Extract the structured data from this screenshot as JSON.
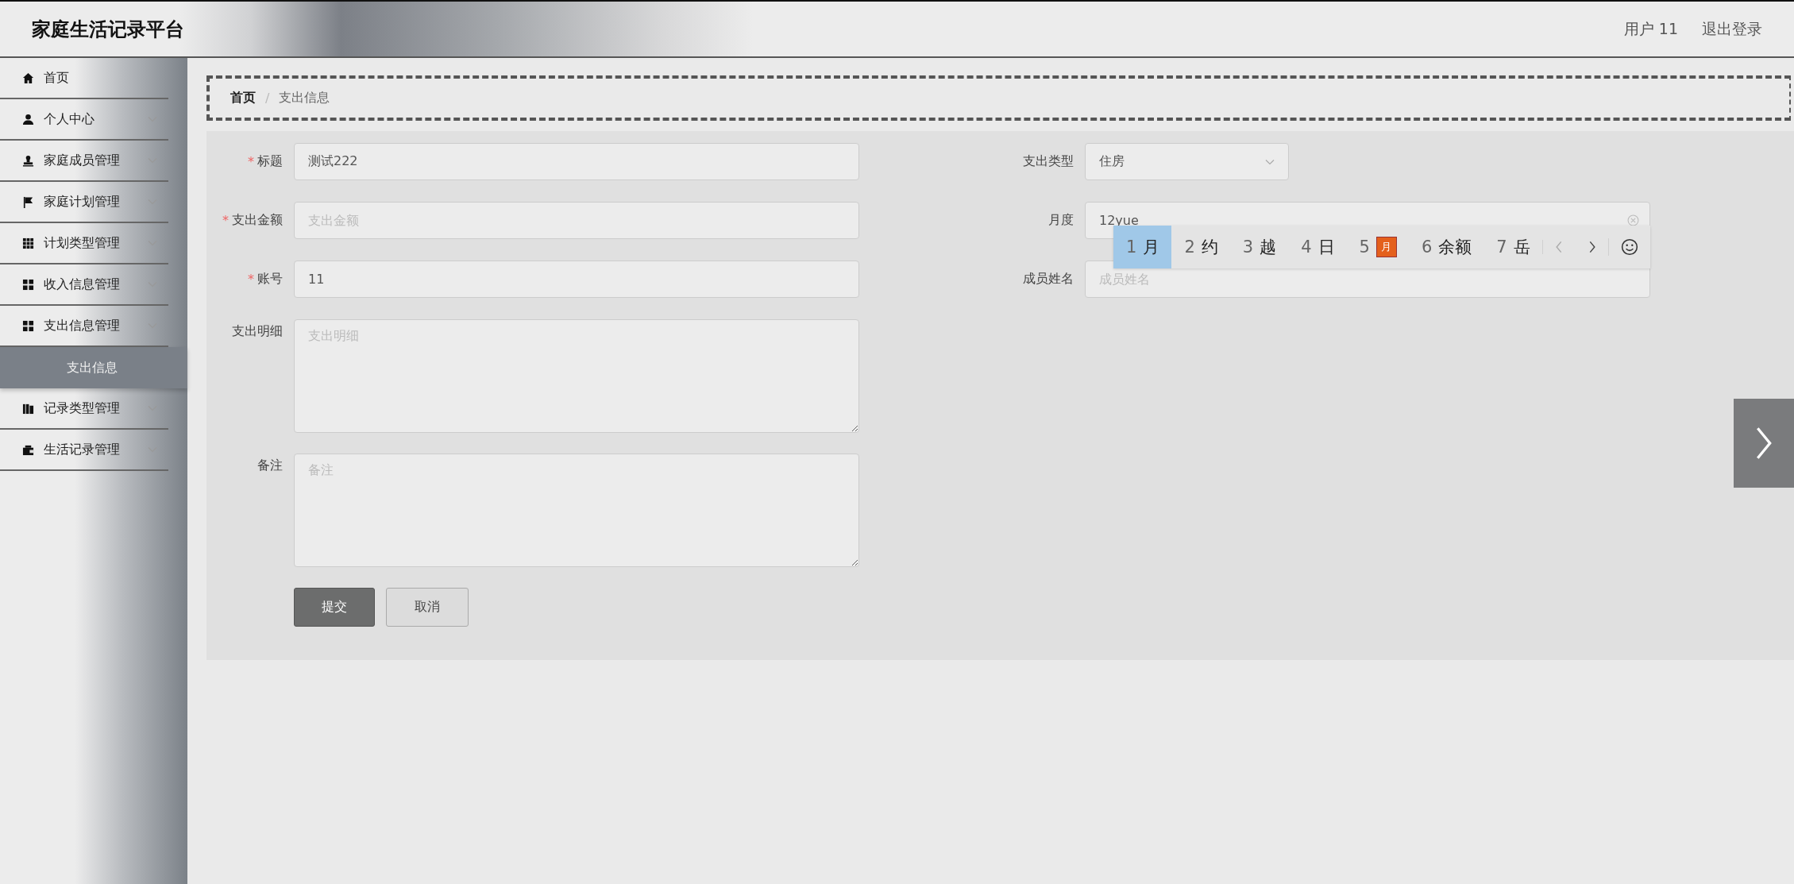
{
  "header": {
    "title": "家庭生活记录平台",
    "user": "用户 11",
    "logout": "退出登录"
  },
  "sidebar": {
    "items": [
      {
        "label": "首页",
        "expandable": false,
        "selected": false
      },
      {
        "label": "个人中心",
        "expandable": true,
        "selected": false
      },
      {
        "label": "家庭成员管理",
        "expandable": true,
        "selected": false
      },
      {
        "label": "家庭计划管理",
        "expandable": true,
        "selected": false
      },
      {
        "label": "计划类型管理",
        "expandable": true,
        "selected": false
      },
      {
        "label": "收入信息管理",
        "expandable": true,
        "selected": false
      },
      {
        "label": "支出信息管理",
        "expandable": true,
        "selected": false,
        "children": [
          {
            "label": "支出信息",
            "selected": true
          }
        ]
      },
      {
        "label": "记录类型管理",
        "expandable": true,
        "selected": false
      },
      {
        "label": "生活记录管理",
        "expandable": true,
        "selected": false
      }
    ]
  },
  "breadcrumb": {
    "separator": "/",
    "items": [
      "首页",
      "支出信息"
    ]
  },
  "form": {
    "left": [
      {
        "label": "标题",
        "required_mark": "*",
        "kind": "input",
        "value": "测试222"
      },
      {
        "label": "支出金额",
        "required_mark": "*",
        "kind": "input",
        "placeholder": "支出金额"
      },
      {
        "label": "账号",
        "required_mark": "*",
        "kind": "input",
        "value": "11"
      },
      {
        "label": "支出明细",
        "kind": "textarea",
        "placeholder": "支出明细"
      },
      {
        "label": "备注",
        "kind": "textarea",
        "placeholder": "备注"
      }
    ],
    "right": [
      {
        "label": "支出类型",
        "kind": "select",
        "value": "住房"
      },
      {
        "label": "月度",
        "kind": "input",
        "value": "12yue",
        "clearable": true
      },
      {
        "label": "成员姓名",
        "kind": "input",
        "placeholder": "成员姓名"
      }
    ],
    "buttons": [
      {
        "label": "提交",
        "kind": "primary"
      },
      {
        "label": "取消",
        "kind": "default"
      }
    ]
  },
  "ime": {
    "candidates": [
      {
        "number": "1",
        "text": "月",
        "kind": "text",
        "selected": true
      },
      {
        "number": "2",
        "text": "约",
        "kind": "text",
        "selected": false
      },
      {
        "number": "3",
        "text": "越",
        "kind": "text",
        "selected": false
      },
      {
        "number": "4",
        "text": "日",
        "kind": "text",
        "selected": false
      },
      {
        "number": "5",
        "text": "月",
        "kind": "badge",
        "selected": false
      },
      {
        "number": "6",
        "text": "余额",
        "kind": "text",
        "selected": false
      },
      {
        "number": "7",
        "text": "岳",
        "kind": "text",
        "selected": false
      }
    ]
  }
}
